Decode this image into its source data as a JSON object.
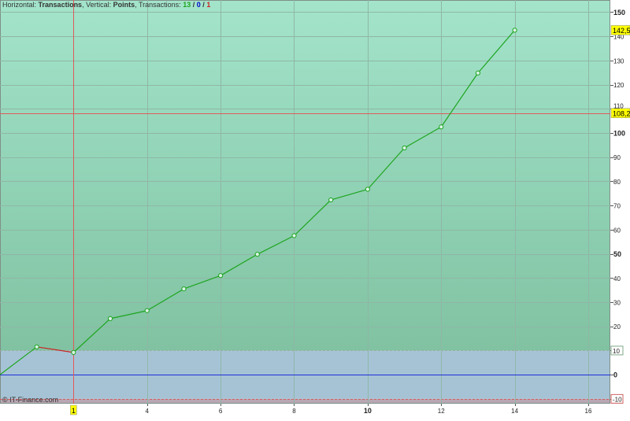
{
  "header": {
    "horizontal_label": "Horizontal:",
    "horizontal_value": "Transactions",
    "vertical_label": "Vertical:",
    "vertical_value": "Points",
    "transactions_label": "Transactions:",
    "count_win": "13",
    "sep1": "/",
    "count_even": "0",
    "sep2": "/",
    "count_loss": "1"
  },
  "footer": {
    "copyright": "© IT-Finance.com"
  },
  "colors": {
    "zone_top": "#a3e4cb",
    "zone_bottom": "#80c2a1",
    "band_fill": "#a6c3d6",
    "below_band_fill": "#b9a7b3",
    "line_up": "#1ea51e",
    "line_down": "#cc2222",
    "zero_line": "#1f2fd8",
    "crosshair": "#e05a5a",
    "label_highlight": "#ffff00",
    "win": "#1ea51e",
    "even": "#0000cc",
    "loss": "#cc2222"
  },
  "chart_data": {
    "type": "line",
    "title": "",
    "xlabel": "",
    "ylabel": "",
    "x_ticks": [
      4,
      6,
      8,
      10,
      12,
      14,
      16
    ],
    "x_bold_ticks": [
      10
    ],
    "y_ticks": [
      -10,
      0,
      10,
      20,
      30,
      40,
      50,
      60,
      70,
      80,
      90,
      100,
      110,
      120,
      130,
      140,
      150
    ],
    "y_bold_ticks": [
      0,
      50,
      100,
      150
    ],
    "y_partial_tick": 110,
    "xlim": [
      0,
      16.6
    ],
    "ylim": [
      -12,
      155
    ],
    "band": [
      -10,
      10
    ],
    "series": [
      {
        "x": [
          0,
          1,
          2,
          3,
          4,
          5,
          6,
          7,
          8,
          9,
          10,
          11,
          12,
          13,
          14
        ],
        "values": [
          0,
          11.5,
          9.2,
          23.2,
          26.5,
          35.5,
          41.0,
          49.8,
          57.5,
          72.3,
          76.7,
          93.8,
          102.5,
          124.8,
          142.5
        ]
      }
    ],
    "crosshair": {
      "x": 2,
      "y": 108.2,
      "x_label": "1",
      "y_label": "108,2"
    },
    "last_value_label": "142,5",
    "grid": true
  }
}
